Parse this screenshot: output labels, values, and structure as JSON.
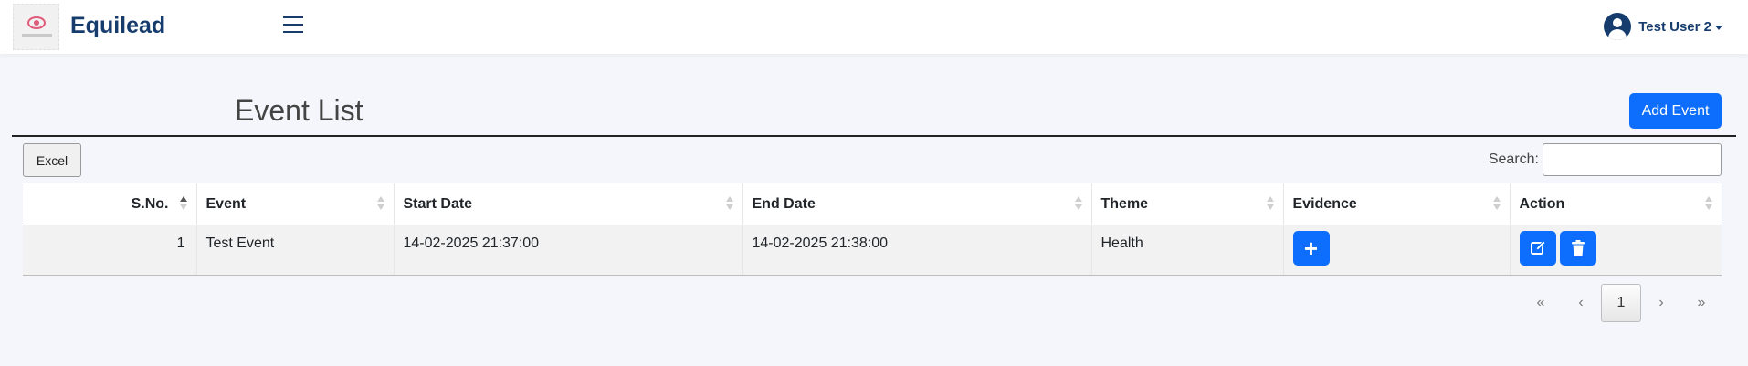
{
  "app": {
    "brand": "Equilead"
  },
  "header": {
    "user_name": "Test User 2"
  },
  "page": {
    "title": "Event List",
    "add_button_label": "Add Event"
  },
  "toolbar": {
    "excel_label": "Excel",
    "search_label": "Search:",
    "search_value": ""
  },
  "table": {
    "columns": [
      "S.No.",
      "Event",
      "Start Date",
      "End Date",
      "Theme",
      "Evidence",
      "Action"
    ],
    "rows": [
      {
        "sno": "1",
        "event": "Test Event",
        "start_date": "14-02-2025 21:37:00",
        "end_date": "14-02-2025 21:38:00",
        "theme": "Health"
      }
    ]
  },
  "pagination": {
    "first": "«",
    "prev": "‹",
    "current": "1",
    "next": "›",
    "last": "»"
  },
  "colors": {
    "brand": "#163c6e",
    "primary": "#0d6efd",
    "background": "#f4f6fb"
  },
  "icons": {
    "menu": "hamburger-icon",
    "user": "user-circle-icon",
    "add": "plus-icon",
    "edit": "edit-icon",
    "delete": "trash-icon"
  }
}
